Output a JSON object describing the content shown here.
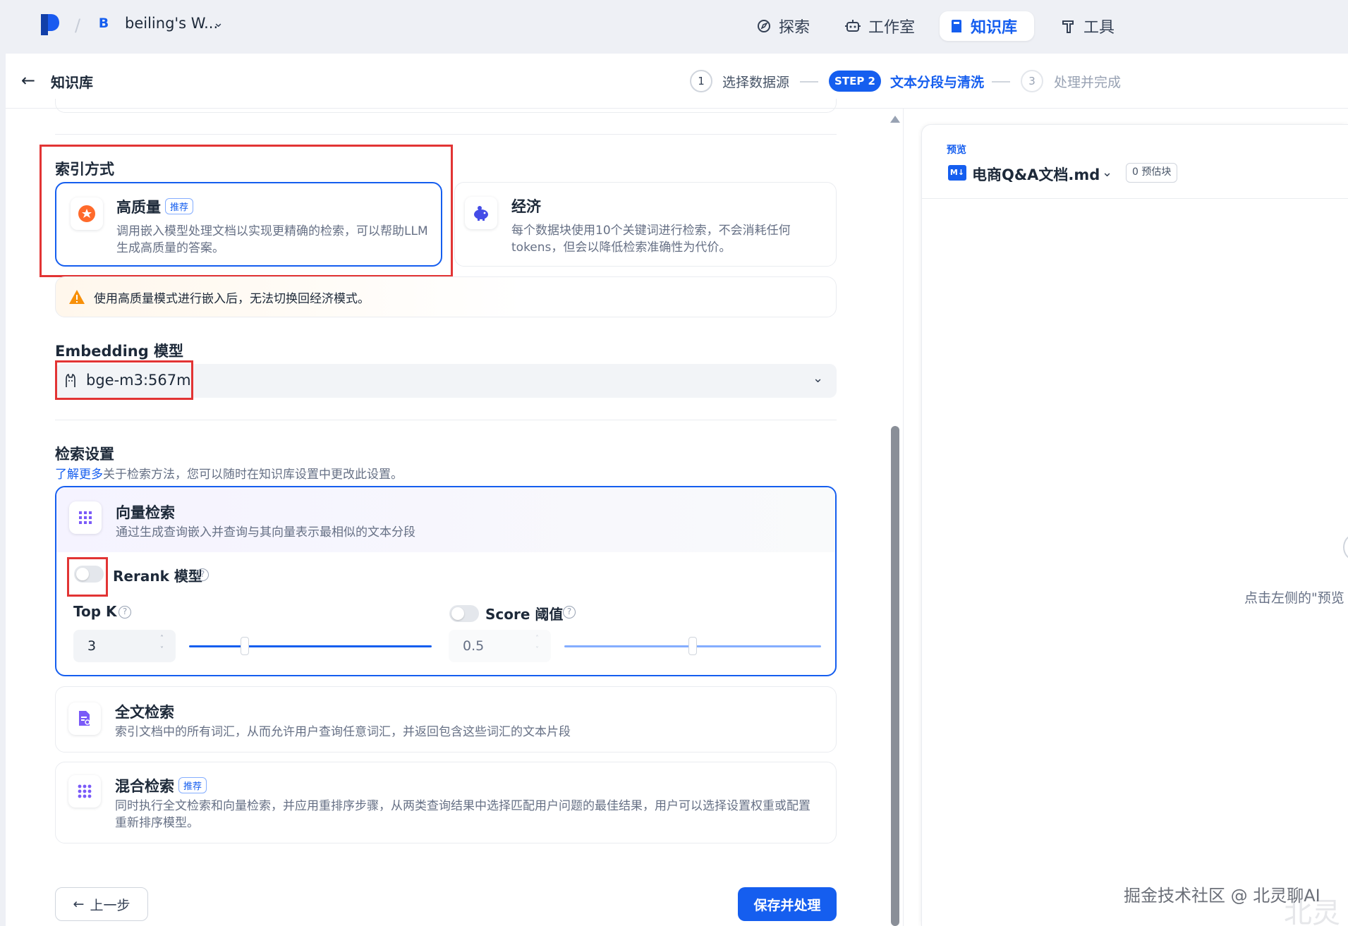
{
  "topbar": {
    "workspace_initial": "B",
    "workspace_name": "beiling's W...",
    "nav": [
      {
        "label": "探索",
        "icon": "compass-icon"
      },
      {
        "label": "工作室",
        "icon": "robot-icon"
      },
      {
        "label": "知识库",
        "icon": "book-icon",
        "active": true
      },
      {
        "label": "工具",
        "icon": "hammer-icon"
      }
    ]
  },
  "header": {
    "back_label": "知识库",
    "steps": [
      {
        "number": "1",
        "label": "选择数据源"
      },
      {
        "number": "STEP 2",
        "label": "文本分段与清洗",
        "current": true
      },
      {
        "number": "3",
        "label": "处理并完成"
      }
    ]
  },
  "index_mode": {
    "title": "索引方式",
    "options": [
      {
        "title": "高质量",
        "tag": "推荐",
        "desc": "调用嵌入模型处理文档以实现更精确的检索，可以帮助LLM生成高质量的答案。",
        "selected": true
      },
      {
        "title": "经济",
        "desc": "每个数据块使用10个关键词进行检索，不会消耗任何tokens，但会以降低检索准确性为代价。"
      }
    ],
    "warning": "使用高质量模式进行嵌入后，无法切换回经济模式。"
  },
  "embedding": {
    "title": "Embedding 模型",
    "model": "bge-m3:567m"
  },
  "retrieval": {
    "title": "检索设置",
    "learn_more_link": "了解更多",
    "learn_more_rest": "关于检索方法，您可以随时在知识库设置中更改此设置。",
    "vector": {
      "title": "向量检索",
      "desc": "通过生成查询嵌入并查询与其向量表示最相似的文本分段",
      "rerank_label": "Rerank 模型",
      "rerank_enabled": false,
      "topk_label": "Top K",
      "topk_value": "3",
      "topk_fraction": 0.23,
      "score_label": "Score 阈值",
      "score_enabled": false,
      "score_value": "0.5",
      "score_fraction": 0.5
    },
    "fulltext": {
      "title": "全文检索",
      "desc": "索引文档中的所有词汇，从而允许用户查询任意词汇，并返回包含这些词汇的文本片段"
    },
    "hybrid": {
      "title": "混合检索",
      "tag": "推荐",
      "desc": "同时执行全文检索和向量检索，并应用重排序步骤，从两类查询结果中选择匹配用户问题的最佳结果，用户可以选择设置权重或配置重新排序模型。"
    }
  },
  "footer": {
    "prev_label": "上一步",
    "save_label": "保存并处理"
  },
  "preview": {
    "label": "预览",
    "file_badge": "M↓",
    "file_name": "电商Q&A文档.md",
    "chunks": "0 预估块",
    "hint": "点击左侧的\"预览"
  },
  "watermark": "掘金技术社区 @ 北灵聊AI",
  "watermark_faint": "北灵",
  "colors": {
    "accent": "#155eef",
    "highlight_box": "#e23434",
    "warning": "#f79009"
  }
}
